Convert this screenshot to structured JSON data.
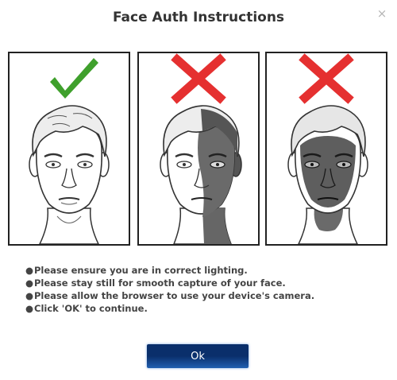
{
  "dialog": {
    "title": "Face Auth Instructions",
    "close_icon": "close-icon",
    "close_glyph": "×"
  },
  "panels": [
    {
      "status": "correct",
      "icon": "checkmark-icon",
      "color": "#3fa02c",
      "lighting": "even"
    },
    {
      "status": "incorrect",
      "icon": "cross-icon",
      "color": "#e53030",
      "lighting": "half-shadow"
    },
    {
      "status": "incorrect",
      "icon": "cross-icon",
      "color": "#e53030",
      "lighting": "full-shadow"
    }
  ],
  "instructions": [
    "Please ensure you are in correct lighting.",
    "Please stay still for smooth capture of your face.",
    "Please allow the browser to use your device's camera.",
    "Click 'OK' to continue."
  ],
  "bullet": "●",
  "ok_button": {
    "label": "Ok",
    "color": "#0a2f6b"
  }
}
